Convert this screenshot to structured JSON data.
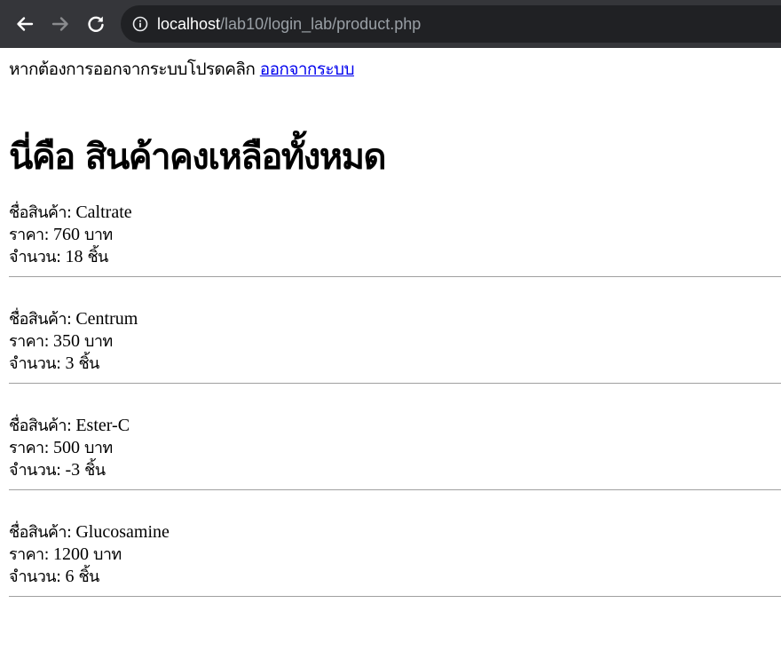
{
  "browser": {
    "url_host": "localhost",
    "url_path": "/lab10/login_lab/product.php"
  },
  "logout": {
    "prompt": "หากต้องการออกจากระบบโปรดคลิก",
    "link_label": "ออกจากระบบ"
  },
  "page_title": "นี่คือ สินค้าคงเหลือทั้งหมด",
  "labels": {
    "name": "ชื่อสินค้า:",
    "price": "ราคา:",
    "quantity": "จำนวน:",
    "currency": "บาท",
    "unit": "ชิ้น"
  },
  "products": [
    {
      "name": "Caltrate",
      "price": "760",
      "quantity": "18"
    },
    {
      "name": "Centrum",
      "price": "350",
      "quantity": "3"
    },
    {
      "name": "Ester-C",
      "price": "500",
      "quantity": "-3"
    },
    {
      "name": "Glucosamine",
      "price": "1200",
      "quantity": "6"
    }
  ]
}
